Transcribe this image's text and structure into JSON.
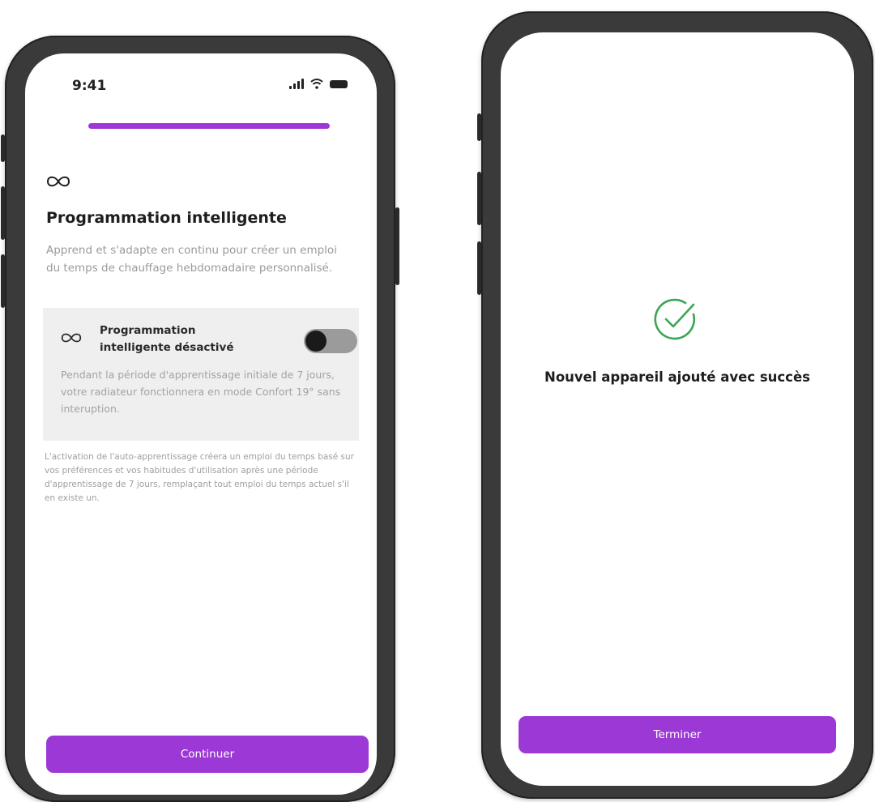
{
  "screen1": {
    "status": {
      "time": "9:41"
    },
    "icon": "infinity-icon",
    "title": "Programmation intelligente",
    "description": "Apprend et s'adapte en continu pour créer un emploi du temps de chauffage hebdomadaire personnalisé.",
    "card": {
      "icon": "infinity-icon",
      "label": "Programmation intelligente désactivé",
      "toggle_on": false,
      "text": "Pendant la période d'apprentissage initiale de 7 jours, votre radiateur fonctionnera en mode Confort 19° sans interuption."
    },
    "footnote": "L'activation de l'auto-apprentissage créera un emploi du temps basé sur vos préférences et vos habitudes d'utilisation après une période d'apprentissage de 7 jours, remplaçant tout emploi du temps actuel s'il en existe un.",
    "button_label": "Continuer"
  },
  "screen2": {
    "icon": "check-circle-icon",
    "title": "Nouvel appareil ajouté avec succès",
    "button_label": "Terminer"
  },
  "colors": {
    "accent": "#9c38d6",
    "success": "#3aa655",
    "card_bg": "#efefef",
    "muted_text": "#9a9a9a"
  }
}
